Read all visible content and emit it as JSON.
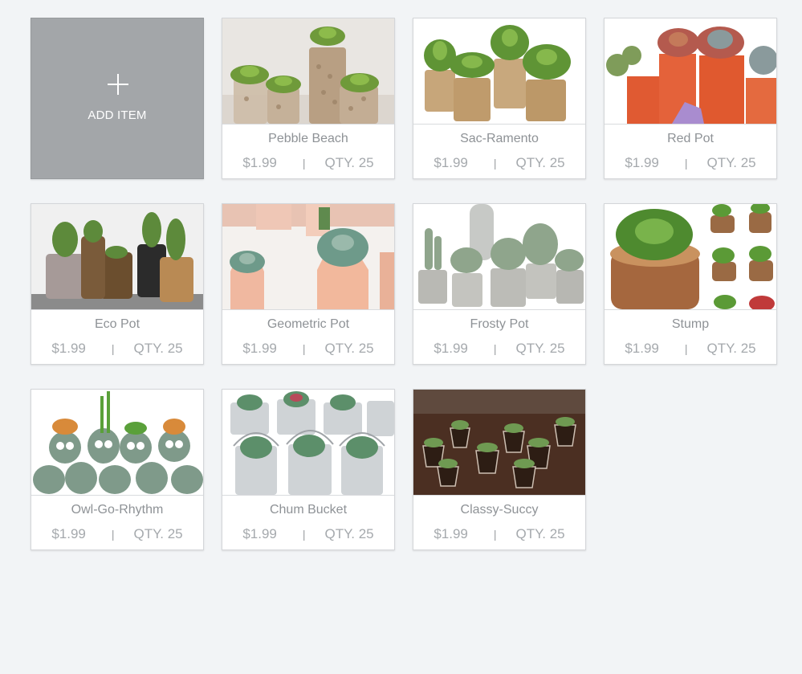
{
  "add_item": {
    "label": "ADD ITEM",
    "icon": "plus-icon"
  },
  "separator": "|",
  "items": [
    {
      "name": "Pebble Beach",
      "price": "$1.99",
      "qty": "QTY. 25",
      "image": "pebble-beach-photo"
    },
    {
      "name": "Sac-Ramento",
      "price": "$1.99",
      "qty": "QTY. 25",
      "image": "sac-ramento-photo"
    },
    {
      "name": "Red Pot",
      "price": "$1.99",
      "qty": "QTY. 25",
      "image": "red-pot-photo"
    },
    {
      "name": "Eco Pot",
      "price": "$1.99",
      "qty": "QTY. 25",
      "image": "eco-pot-photo"
    },
    {
      "name": "Geometric Pot",
      "price": "$1.99",
      "qty": "QTY. 25",
      "image": "geometric-pot-photo"
    },
    {
      "name": "Frosty Pot",
      "price": "$1.99",
      "qty": "QTY. 25",
      "image": "frosty-pot-photo"
    },
    {
      "name": "Stump",
      "price": "$1.99",
      "qty": "QTY. 25",
      "image": "stump-photo"
    },
    {
      "name": "Owl-Go-Rhythm",
      "price": "$1.99",
      "qty": "QTY. 25",
      "image": "owl-go-rhythm-photo"
    },
    {
      "name": "Chum Bucket",
      "price": "$1.99",
      "qty": "QTY. 25",
      "image": "chum-bucket-photo"
    },
    {
      "name": "Classy-Succy",
      "price": "$1.99",
      "qty": "QTY. 25",
      "image": "classy-succy-photo"
    }
  ]
}
